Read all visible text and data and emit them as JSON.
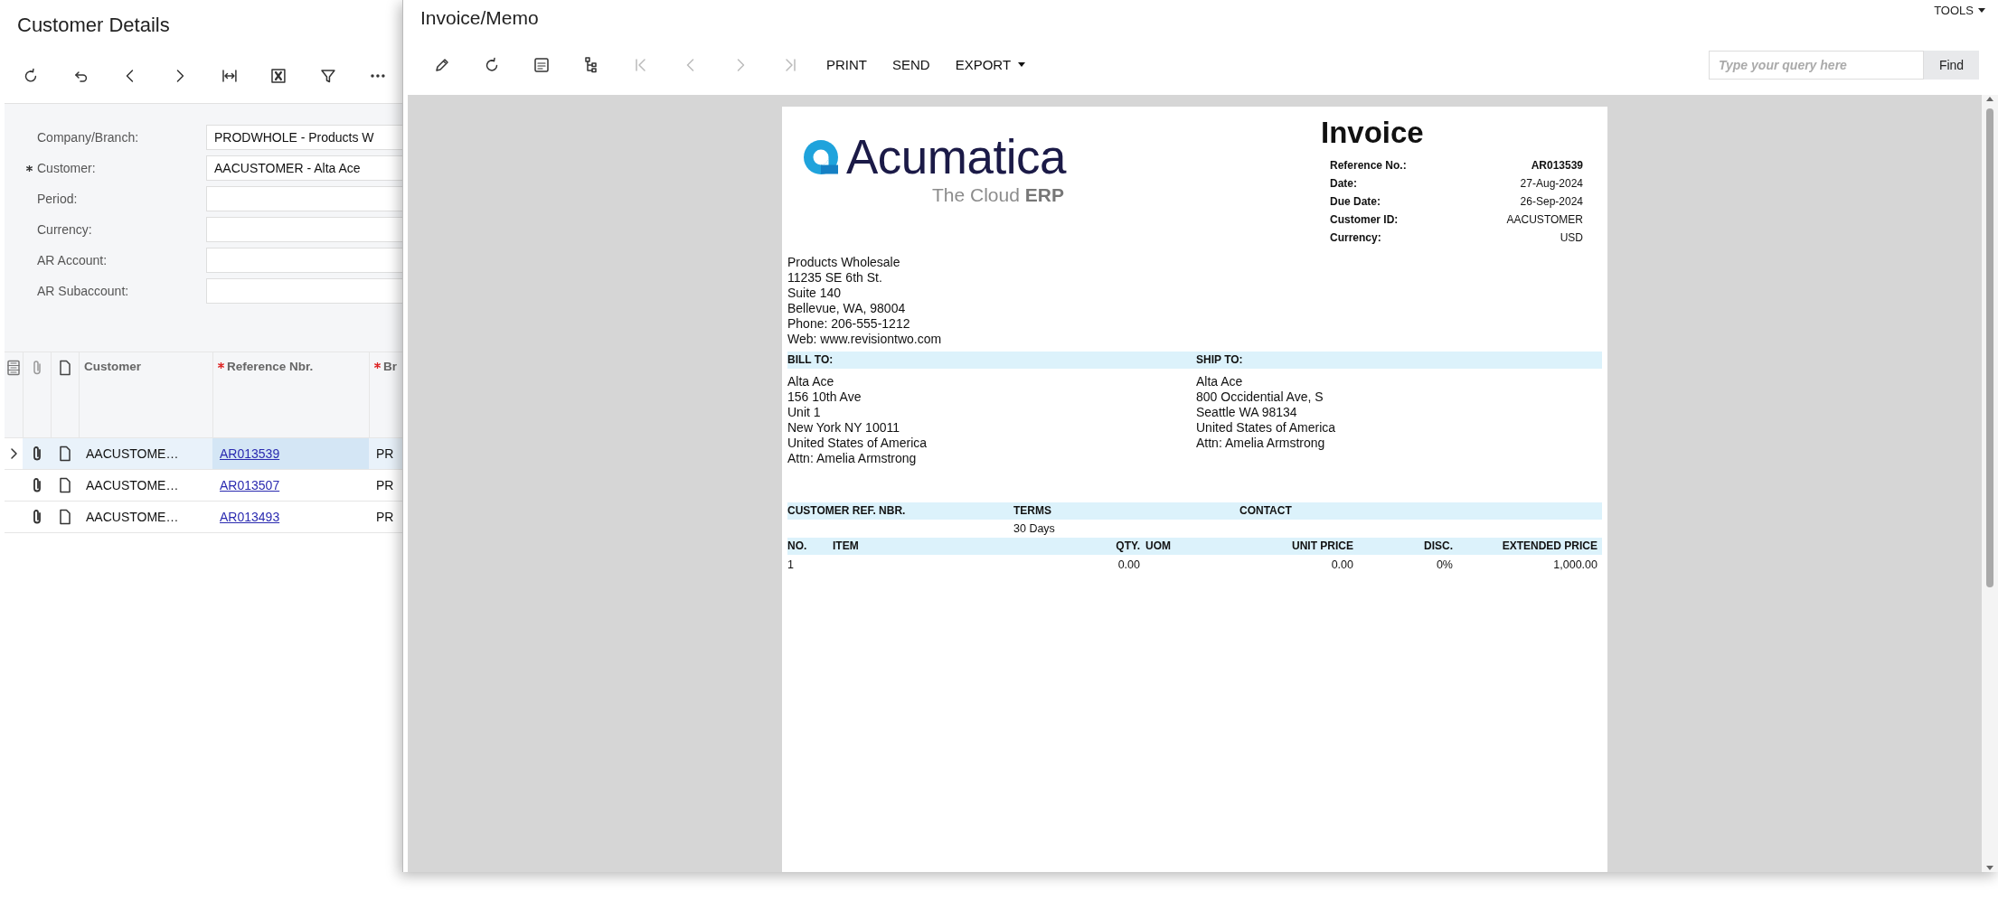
{
  "customer_details": {
    "title": "Customer Details",
    "form": [
      {
        "label": "Company/Branch:",
        "required": false,
        "value": "PRODWHOLE - Products W"
      },
      {
        "label": "Customer:",
        "required": true,
        "value": "AACUSTOMER - Alta Ace"
      },
      {
        "label": "Period:",
        "required": false
      },
      {
        "label": "Currency:",
        "required": false
      },
      {
        "label": "AR Account:",
        "required": false
      },
      {
        "label": "AR Subaccount:",
        "required": false
      }
    ],
    "grid": {
      "columns": [
        {
          "label": "Customer",
          "required": false
        },
        {
          "label": "Reference Nbr.",
          "required": true
        },
        {
          "label": "Br",
          "required": true
        }
      ],
      "rows": [
        {
          "selected": true,
          "customer": "AACUSTOME…",
          "reference": "AR013539",
          "branch": "PR"
        },
        {
          "selected": false,
          "customer": "AACUSTOME…",
          "reference": "AR013507",
          "branch": "PR"
        },
        {
          "selected": false,
          "customer": "AACUSTOME…",
          "reference": "AR013493",
          "branch": "PR"
        }
      ]
    }
  },
  "dialog": {
    "title": "Invoice/Memo",
    "tools_menu": "TOOLS",
    "icon_buttons": [
      {
        "disabled": false
      },
      {
        "disabled": false
      },
      {
        "disabled": false
      },
      {
        "disabled": false
      },
      {
        "disabled": true
      },
      {
        "disabled": true
      },
      {
        "disabled": true
      },
      {
        "disabled": true
      }
    ],
    "text_buttons": [
      {
        "label": "PRINT",
        "kind": "button"
      },
      {
        "label": "SEND",
        "kind": "button"
      },
      {
        "label": "EXPORT",
        "kind": "dropdown"
      }
    ],
    "search": {
      "placeholder": "Type your query here",
      "button": "Find"
    },
    "invoice": {
      "logo": {
        "name": "Acumatica",
        "tagline": "The Cloud **ERP**"
      },
      "title": "Invoice",
      "details": [
        {
          "label": "Reference No.:",
          "value": "AR013539",
          "bold": true
        },
        {
          "label": "Date:",
          "value": "27-Aug-2024",
          "bold": false
        },
        {
          "label": "Due Date:",
          "value": "26-Sep-2024",
          "bold": false
        },
        {
          "label": "Customer ID:",
          "value": "AACUSTOMER",
          "bold": false
        },
        {
          "label": "Currency:",
          "value": "USD",
          "bold": false
        }
      ],
      "company_address": [
        "Products Wholesale",
        "11235 SE 6th St.",
        "Suite 140",
        "Bellevue, WA, 98004",
        "Phone: 206-555-1212",
        "Web: www.revisiontwo.com"
      ],
      "bill_to": {
        "heading": "BILL TO:",
        "lines": [
          "Alta Ace",
          "156 10th Ave",
          "Unit 1",
          "New York NY 10011",
          "United States of America",
          "Attn: Amelia Armstrong"
        ]
      },
      "ship_to": {
        "heading": "SHIP TO:",
        "lines": [
          "Alta Ace",
          "800 Occidential Ave, S",
          "Seattle WA 98134",
          "United States of America",
          "Attn: Amelia Armstrong"
        ]
      },
      "info_table": [
        {
          "heading": "CUSTOMER REF. NBR."
        },
        {
          "heading": "TERMS",
          "value": "30 Days"
        },
        {
          "heading": "CONTACT"
        }
      ],
      "lines_table": {
        "columns": [
          "NO.",
          "ITEM",
          "QTY.",
          "UOM",
          "UNIT PRICE",
          "DISC.",
          "EXTENDED PRICE"
        ],
        "rows": [
          {
            "no": "1",
            "qty": "0.00",
            "unit_price": "0.00",
            "disc": "0%",
            "extended_price": "1,000.00"
          }
        ]
      }
    }
  }
}
